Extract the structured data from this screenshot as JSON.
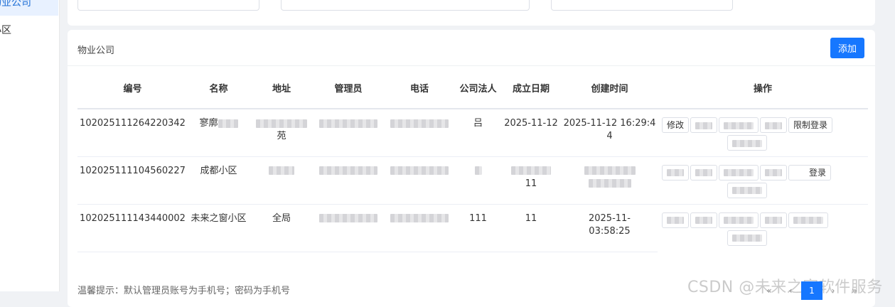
{
  "sidebar": {
    "items": [
      {
        "label": "物业公司",
        "active": true
      },
      {
        "label": "小区",
        "active": false
      }
    ]
  },
  "panel": {
    "title": "物业公司",
    "add_label": "添加",
    "tip": "温馨提示：默认管理员账号为手机号；密码为手机号"
  },
  "table": {
    "columns": [
      "编号",
      "名称",
      "地址",
      "管理员",
      "电话",
      "公司法人",
      "成立日期",
      "创建时间",
      "操作"
    ],
    "rows": [
      {
        "id": "102025111264220342",
        "name": "寥廓",
        "address": "苑",
        "admin": "",
        "phone": "",
        "legal": "吕",
        "founded": "2025-11-12",
        "created": "2025-11-12 16:29:44",
        "op_edit": "修改",
        "op_restrict": "限制登录"
      },
      {
        "id": "102025111104560227",
        "name": "成都小区",
        "address": "",
        "admin": "",
        "phone": "",
        "legal": "",
        "founded": "11",
        "created": "",
        "op_restrict": "登录"
      },
      {
        "id": "102025111143440002",
        "name": "未来之窗小区",
        "address": "全局",
        "admin": "",
        "phone": "",
        "legal": "111",
        "founded": "11",
        "created": "2025-11-\n03:58:25"
      }
    ]
  },
  "pager": {
    "first": "«",
    "prev": "‹",
    "current": "1",
    "next": "›",
    "last": "»"
  },
  "watermark": "CSDN @未来之窗软件服务",
  "colors": {
    "primary": "#1677ff",
    "background": "#f0f2f5",
    "sidebar_active_bg": "#e8f1ff"
  }
}
